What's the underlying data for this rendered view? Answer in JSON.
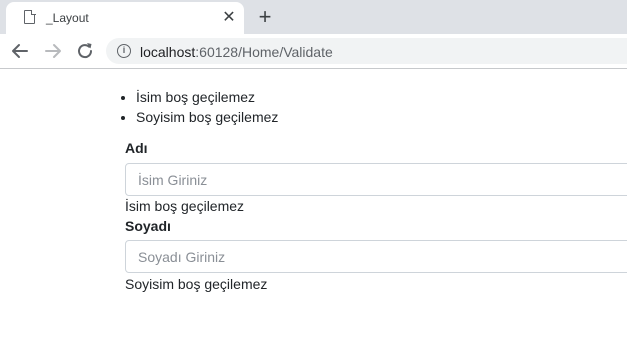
{
  "browser": {
    "tab_title": "_Layout",
    "tab_close": "✕",
    "new_tab": "+",
    "url_host": "localhost",
    "url_rest": ":60128/Home/Validate"
  },
  "validation_summary": {
    "items": [
      "İsim boş geçilemez",
      "Soyisim boş geçilemez"
    ]
  },
  "form": {
    "first_name": {
      "label": "Adı",
      "placeholder": "İsim Giriniz",
      "value": "",
      "error": "İsim boş geçilemez"
    },
    "last_name": {
      "label": "Soyadı",
      "placeholder": "Soyadı Giriniz",
      "value": "",
      "error": "Soyisim boş geçilemez"
    }
  },
  "colors": {
    "tabstrip": "#dee1e6",
    "omnibox": "#f1f3f4",
    "input_border": "#ced4da",
    "text": "#212529"
  }
}
